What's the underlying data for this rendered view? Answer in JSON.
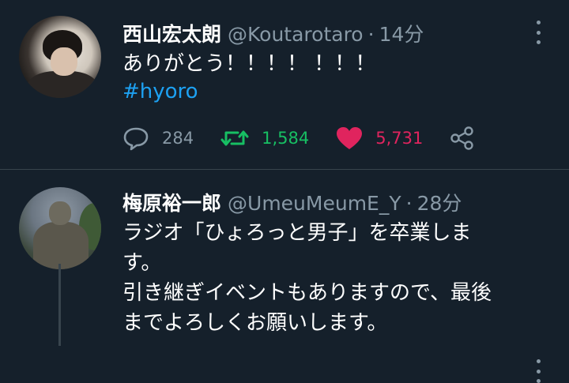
{
  "tweets": [
    {
      "name": "西山宏太朗",
      "handle": "@Koutarotaro",
      "time": "14分",
      "text": "ありがとう！！！！ ！！！",
      "hashtag": "#hyoro",
      "reply_count": "284",
      "retweet_count": "1,584",
      "like_count": "5,731"
    },
    {
      "name": "梅原裕一郎",
      "handle": "@UmeuMeumE_Y",
      "time": "28分",
      "lines": [
        "ラジオ「ひょろっと男子」を卒業しま",
        "す。",
        "引き継ぎイベントもありますので、最後",
        "までよろしくお願いします。"
      ]
    }
  ],
  "colors": {
    "background": "#15202b",
    "secondary_text": "#8899a6",
    "link": "#1da1f2",
    "retweet": "#17bf63",
    "like": "#e0245e"
  },
  "icons": [
    "reply-icon",
    "retweet-icon",
    "heart-icon",
    "share-icon",
    "more-icon"
  ]
}
